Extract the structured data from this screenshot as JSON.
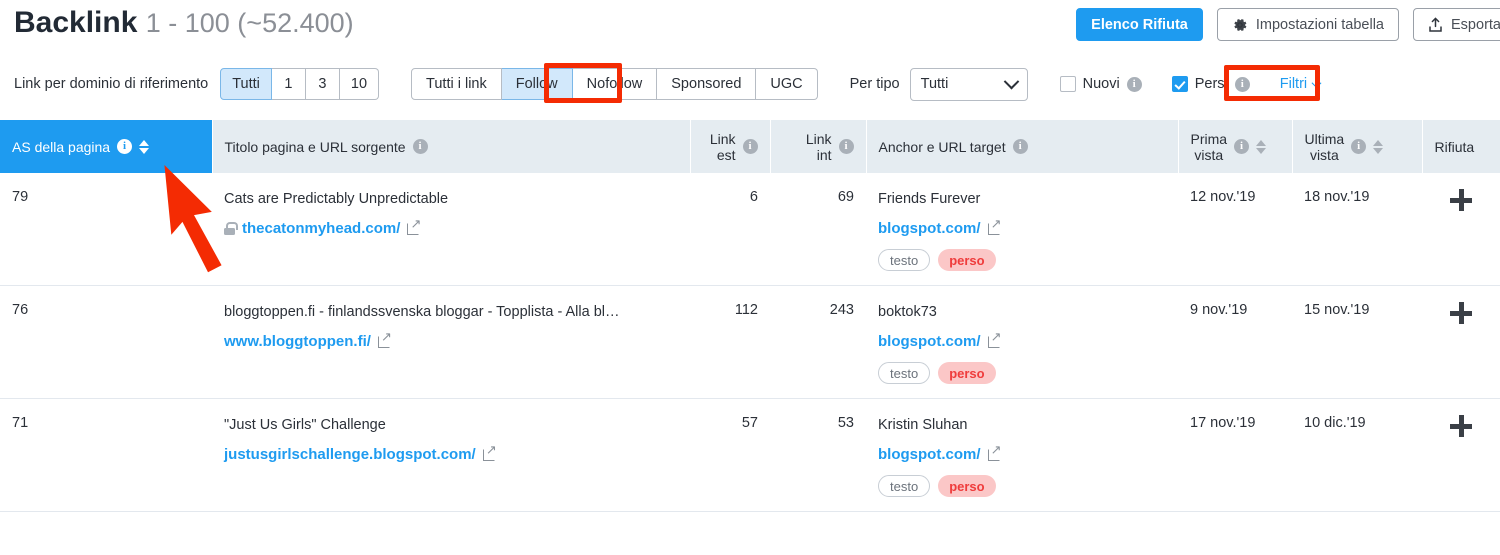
{
  "header": {
    "title_main": "Backlink",
    "title_sub": "1 - 100 (~52.400)",
    "buttons": {
      "disavow_label": "Elenco Rifiuta",
      "settings_label": "Impostazioni tabella",
      "settings_icon": "gear-icon",
      "export_label": "Esporta",
      "export_icon": "upload-icon"
    }
  },
  "filters": {
    "links_per_domain_label": "Link per dominio di riferimento",
    "links_per_domain_options": [
      "Tutti",
      "1",
      "3",
      "10"
    ],
    "links_per_domain_selected": "Tutti",
    "link_type_options": [
      "Tutti i link",
      "Follow",
      "Nofollow",
      "Sponsored",
      "UGC"
    ],
    "link_type_selected": "Follow",
    "per_tipo_label": "Per tipo",
    "per_tipo_value": "Tutti",
    "nuovi_label": "Nuovi",
    "nuovi_checked": false,
    "persi_label": "Persi",
    "persi_checked": true,
    "filtri_label": "Filtri",
    "accent_color": "#1e9bf0",
    "annotation_color": "#f42b03"
  },
  "table": {
    "columns": {
      "as_pagina": "AS della pagina",
      "titolo": "Titolo pagina e URL sorgente",
      "link_est_l1": "Link",
      "link_est_l2": "est",
      "link_int_l1": "Link",
      "link_int_l2": "int",
      "anchor": "Anchor e URL target",
      "prima_vista_l1": "Prima",
      "prima_vista_l2": "vista",
      "ultima_vista_l1": "Ultima",
      "ultima_vista_l2": "vista",
      "rifiuta": "Rifiuta"
    },
    "rows": [
      {
        "as": "79",
        "title": "Cats are Predictably Unpredictable",
        "source_url": "thecatonmyhead.com/",
        "has_lock": true,
        "link_est": "6",
        "link_int": "69",
        "anchor": "Friends Furever",
        "target_url": "blogspot.com/",
        "tags": [
          "testo",
          "perso"
        ],
        "prima_vista": "12 nov.'19",
        "ultima_vista": "18 nov.'19"
      },
      {
        "as": "76",
        "title": "bloggtoppen.fi - finlandssvenska bloggar - Topplista - Alla bl…",
        "source_url": "www.bloggtoppen.fi/",
        "has_lock": false,
        "link_est": "112",
        "link_int": "243",
        "anchor": "boktok73",
        "target_url": "blogspot.com/",
        "tags": [
          "testo",
          "perso"
        ],
        "prima_vista": "9 nov.'19",
        "ultima_vista": "15 nov.'19"
      },
      {
        "as": "71",
        "title": "\"Just Us Girls\" Challenge",
        "source_url": "justusgirlschallenge.blogspot.com/",
        "has_lock": false,
        "link_est": "57",
        "link_int": "53",
        "anchor": "Kristin Sluhan",
        "target_url": "blogspot.com/",
        "tags": [
          "testo",
          "perso"
        ],
        "prima_vista": "17 nov.'19",
        "ultima_vista": "10 dic.'19"
      }
    ]
  }
}
